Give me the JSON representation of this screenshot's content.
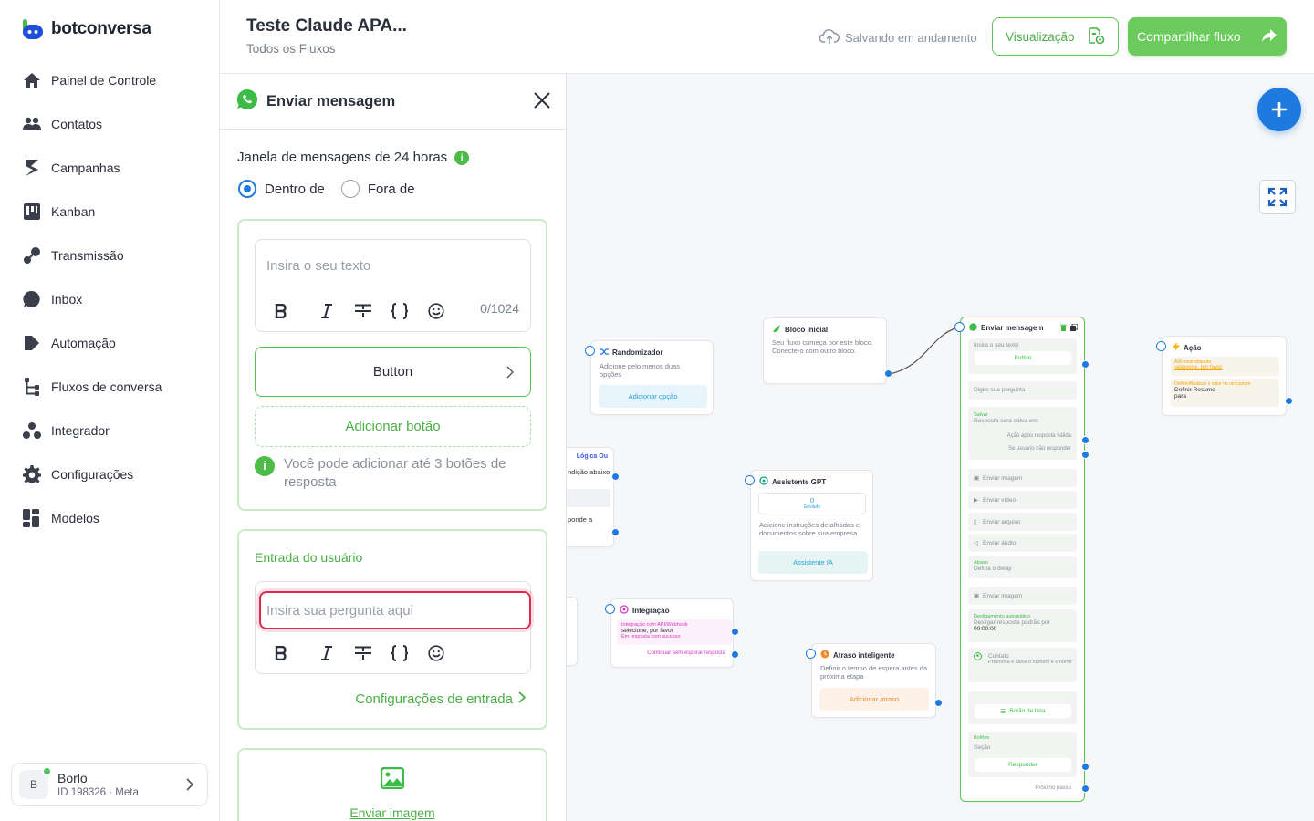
{
  "brand": {
    "name": "botconversa",
    "accent": "#4cbb47",
    "blue": "#1f7ae0"
  },
  "sidebar": {
    "items": [
      {
        "label": "Painel de Controle",
        "icon": "home-icon"
      },
      {
        "label": "Contatos",
        "icon": "users-icon"
      },
      {
        "label": "Campanhas",
        "icon": "campaign-icon"
      },
      {
        "label": "Kanban",
        "icon": "kanban-icon"
      },
      {
        "label": "Transmissão",
        "icon": "broadcast-icon"
      },
      {
        "label": "Inbox",
        "icon": "chat-bubble-icon"
      },
      {
        "label": "Automação",
        "icon": "automation-icon"
      },
      {
        "label": "Fluxos de conversa",
        "icon": "flow-icon"
      },
      {
        "label": "Integrador",
        "icon": "integrator-icon"
      },
      {
        "label": "Configurações",
        "icon": "gear-icon"
      },
      {
        "label": "Modelos",
        "icon": "templates-icon"
      }
    ],
    "user": {
      "initial": "B",
      "name": "Borlo",
      "id_line": "ID 198326 · Meta"
    }
  },
  "header": {
    "title": "Teste Claude APA...",
    "breadcrumb": "Todos os Fluxos",
    "saving": "Salvando em andamento",
    "preview_label": "Visualização",
    "share_label": "Compartilhar fluxo"
  },
  "panel": {
    "title": "Enviar mensagem",
    "window_label": "Janela de mensagens de 24 horas",
    "radio_inside": "Dentro de",
    "radio_outside": "Fora de",
    "text_placeholder": "Insira o seu texto",
    "counter": "0/1024",
    "button_label": "Button",
    "add_button": "Adicionar botão",
    "buttons_note": "Você pode adicionar até 3 botões de resposta",
    "user_input_title": "Entrada do usuário",
    "question_placeholder": "Insira sua pergunta aqui",
    "input_settings": "Configurações de entrada",
    "send_image": "Enviar imagem"
  },
  "canvas": {
    "randomizer": {
      "title": "Randomizador",
      "desc": "Adicione pelo menos duas opções",
      "action": "Adicionar opção"
    },
    "start": {
      "title": "Bloco Inicial",
      "desc": "Seu fluxo começa por este bloco. Conecte-o com outro bloco."
    },
    "logic": {
      "title": "Lógica Ou",
      "line1": "ndição abaixo",
      "line2": "ponde a"
    },
    "gpt": {
      "title": "Assistente GPT",
      "count": "0",
      "count_label": "Enviado",
      "desc": "Adicione instruções detalhadas e documentos sobre sua empresa",
      "action": "Assistente IA"
    },
    "integration": {
      "title": "Integração",
      "line1": "Integração com API/Webhook",
      "line2": "selecione, por favor",
      "line3": "Em resposta com sucesso",
      "line4": "Continuar sem esperar resposta"
    },
    "delay": {
      "title": "Atraso inteligente",
      "desc": "Definir o tempo de espera antes da próxima etapa",
      "action": "Adicionar atraso"
    },
    "action": {
      "title": "Ação",
      "l1": "Adicionar etiqueta",
      "l2": "selecione, por favor",
      "l3": "Definir/Atualizar o valor de um campo",
      "l4": "Definir Resumo",
      "l5": "para"
    },
    "send": {
      "title": "Enviar mensagem",
      "text": "Insira o seu texto",
      "button": "Button",
      "question": "Digite sua pergunta",
      "save": "Salvar",
      "save_desc": "Resposta será salva em:",
      "valid": "Ação após resposta válida",
      "noreply": "Se usuário não responder",
      "img1": "Enviar imagem",
      "video": "Enviar vídeo",
      "file": "Enviar arquivo",
      "audio": "Enviar áudio",
      "delay": "Atraso",
      "delay_desc": "Defina o delay",
      "img2": "Enviar imagem",
      "auto_off": "Desligamento automático",
      "auto_off_desc": "Desligar resposta padrão por",
      "auto_off_time": "00:00:00",
      "contact": "Contato",
      "contact_desc": "Preencha e salve o número e o nome",
      "list_button": "Botão de lista",
      "buttons": "Botões",
      "section": "Seção",
      "reply": "Responder",
      "next": "Próximo passo"
    }
  }
}
